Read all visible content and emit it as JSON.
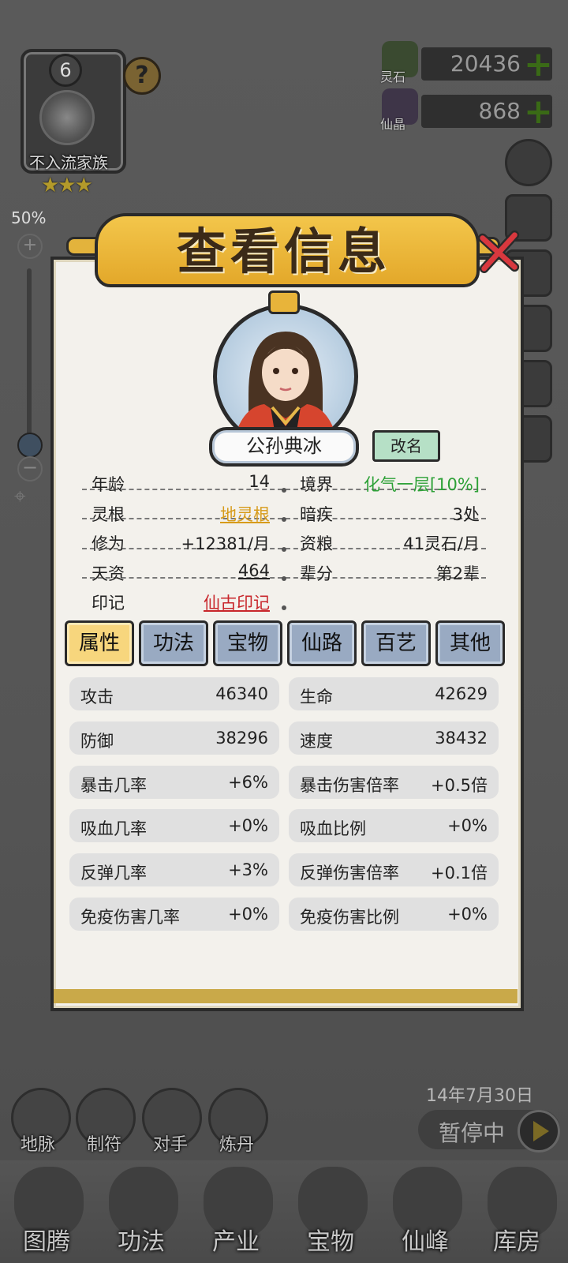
{
  "clan": {
    "level": "6",
    "name": "不入流家族",
    "stars": "★★★",
    "help": "?"
  },
  "zoom": {
    "percent": "50%",
    "plus": "+",
    "minus": "−",
    "level": 0.1
  },
  "resources": [
    {
      "label": "灵石",
      "value": "20436",
      "plus": "+",
      "color": "#3a6a16"
    },
    {
      "label": "仙晶",
      "value": "868",
      "plus": "+",
      "color": "#5a3f7a"
    }
  ],
  "modal": {
    "title": "查看信息",
    "name": "公孙典冰",
    "rename": "改名",
    "info": [
      {
        "left_key": "年龄",
        "left_val": "14",
        "right_key": "境界",
        "right_val": "化气一层[10%]"
      },
      {
        "left_key": "灵根",
        "left_val": "地灵根",
        "right_key": "暗疾",
        "right_val": "3处"
      },
      {
        "left_key": "修为",
        "left_val": "+12381/月",
        "right_key": "资粮",
        "right_val": "41灵石/月"
      },
      {
        "left_key": "天资",
        "left_val": "464",
        "right_key": "辈分",
        "right_val": "第2辈"
      },
      {
        "left_key": "印记",
        "left_val": "仙古印记"
      }
    ],
    "tabs": [
      "属性",
      "功法",
      "宝物",
      "仙路",
      "百艺",
      "其他"
    ],
    "active_tab": "属性",
    "stats": [
      {
        "k1": "攻击",
        "v1": "46340",
        "k2": "生命",
        "v2": "42629"
      },
      {
        "k1": "防御",
        "v1": "38296",
        "k2": "速度",
        "v2": "38432"
      },
      {
        "k1": "暴击几率",
        "v1": "+6%",
        "k2": "暴击伤害倍率",
        "v2": "+0.5倍"
      },
      {
        "k1": "吸血几率",
        "v1": "+0%",
        "k2": "吸血比例",
        "v2": "+0%"
      },
      {
        "k1": "反弹几率",
        "v1": "+3%",
        "k2": "反弹伤害倍率",
        "v2": "+0.1倍"
      },
      {
        "k1": "免疫伤害几率",
        "v1": "+0%",
        "k2": "免疫伤害比例",
        "v2": "+0%"
      }
    ]
  },
  "shortcuts": [
    "地脉",
    "制符",
    "对手",
    "炼丹"
  ],
  "date": "14年7月30日",
  "pause": "暂停中",
  "nav": [
    "图腾",
    "功法",
    "产业",
    "宝物",
    "仙峰",
    "库房"
  ],
  "colors": {
    "accent": "#e3a82a",
    "tab": "#99aac2",
    "tab_active": "#f7d67d",
    "stat_bg": "#e0e0e0"
  }
}
